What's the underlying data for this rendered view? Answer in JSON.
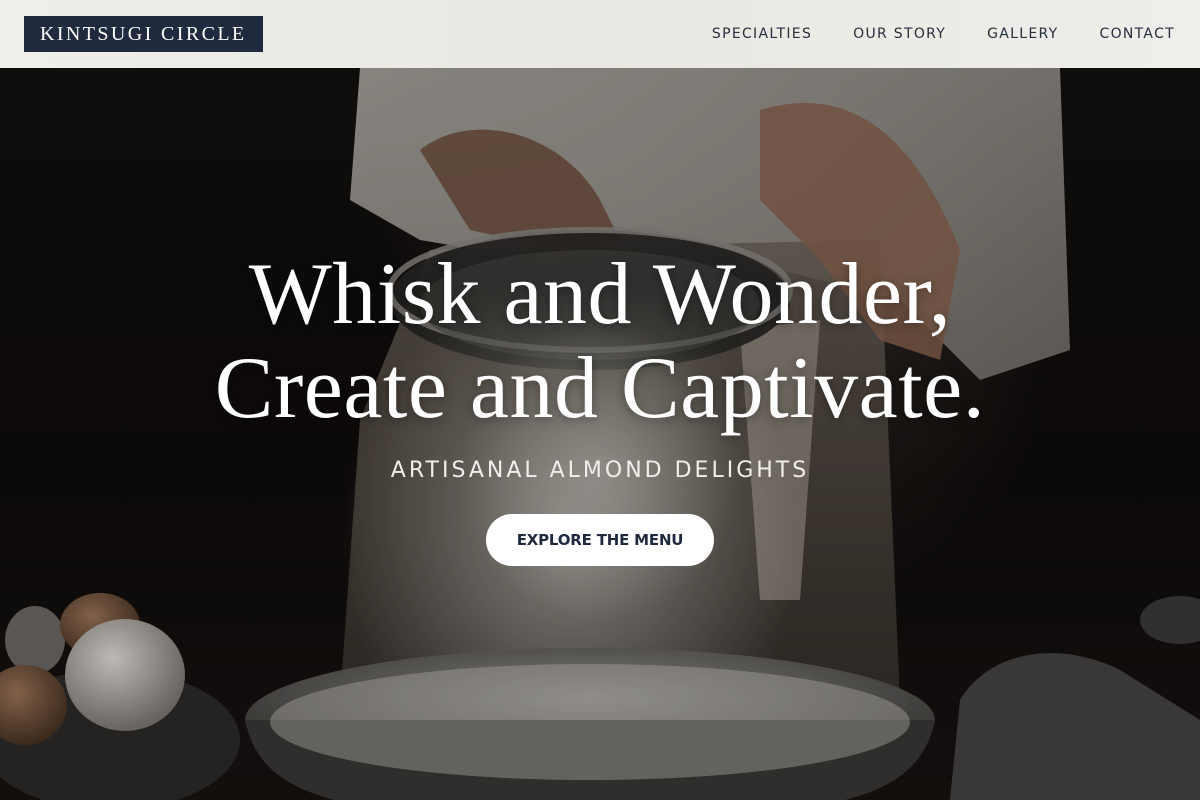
{
  "header": {
    "logo_text": "KINTSUGI CIRCLE",
    "nav": [
      {
        "label": "SPECIALTIES"
      },
      {
        "label": "OUR STORY"
      },
      {
        "label": "GALLERY"
      },
      {
        "label": "CONTACT"
      }
    ]
  },
  "hero": {
    "headline_line1": "Whisk and Wonder,",
    "headline_line2": "Create and Captivate.",
    "subtitle": "ARTISANAL ALMOND DELIGHTS",
    "cta_label": "EXPLORE THE MENU"
  },
  "colors": {
    "header_bg": "#efeeea",
    "logo_bg": "#1f2a3e",
    "nav_text": "#262f3d",
    "cta_bg": "#ffffff",
    "cta_text": "#1f2a3e",
    "hero_text": "#ffffff"
  }
}
